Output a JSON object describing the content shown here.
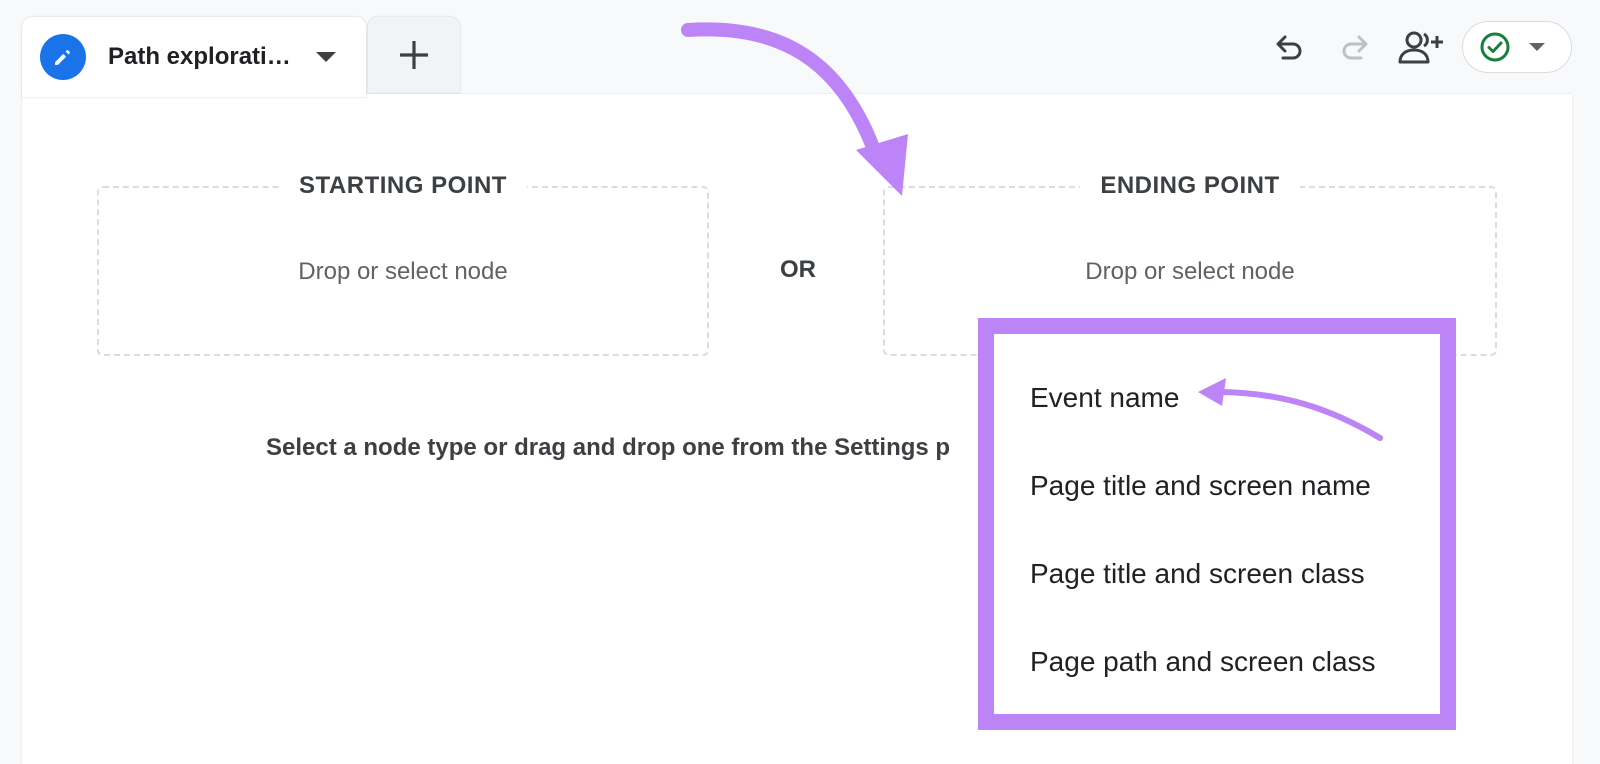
{
  "tab": {
    "title": "Path explorati…"
  },
  "path": {
    "starting_point": {
      "title": "STARTING POINT",
      "hint": "Drop or select node"
    },
    "or_label": "OR",
    "ending_point": {
      "title": "ENDING POINT",
      "hint": "Drop or select node"
    },
    "instruction": "Select a node type or drag and drop one from the Settings p"
  },
  "node_menu": {
    "items": [
      "Event name",
      "Page title and screen name",
      "Page title and screen class",
      "Page path and screen class"
    ]
  },
  "colors": {
    "accent_blue": "#1a73e8",
    "highlight_purple": "#bd84f8",
    "status_green": "#188038"
  },
  "icons": {
    "tab": "pencil-icon",
    "add_tab": "plus-icon",
    "undo": "undo-icon",
    "redo": "redo-icon",
    "share": "add-person-icon",
    "status": "check-circle-icon"
  }
}
